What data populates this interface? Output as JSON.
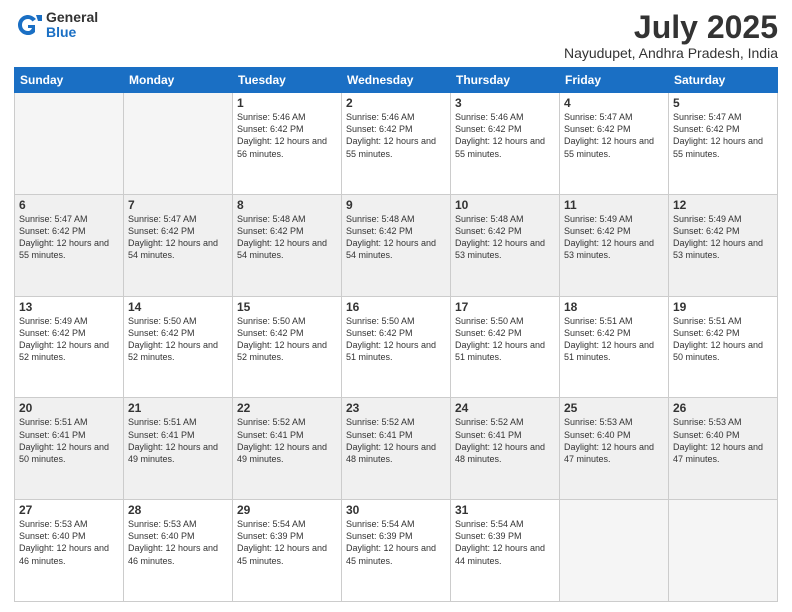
{
  "header": {
    "logo_general": "General",
    "logo_blue": "Blue",
    "title": "July 2025",
    "subtitle": "Nayudupet, Andhra Pradesh, India"
  },
  "weekdays": [
    "Sunday",
    "Monday",
    "Tuesday",
    "Wednesday",
    "Thursday",
    "Friday",
    "Saturday"
  ],
  "weeks": [
    [
      {
        "day": "",
        "info": ""
      },
      {
        "day": "",
        "info": ""
      },
      {
        "day": "1",
        "info": "Sunrise: 5:46 AM\nSunset: 6:42 PM\nDaylight: 12 hours and 56 minutes."
      },
      {
        "day": "2",
        "info": "Sunrise: 5:46 AM\nSunset: 6:42 PM\nDaylight: 12 hours and 55 minutes."
      },
      {
        "day": "3",
        "info": "Sunrise: 5:46 AM\nSunset: 6:42 PM\nDaylight: 12 hours and 55 minutes."
      },
      {
        "day": "4",
        "info": "Sunrise: 5:47 AM\nSunset: 6:42 PM\nDaylight: 12 hours and 55 minutes."
      },
      {
        "day": "5",
        "info": "Sunrise: 5:47 AM\nSunset: 6:42 PM\nDaylight: 12 hours and 55 minutes."
      }
    ],
    [
      {
        "day": "6",
        "info": "Sunrise: 5:47 AM\nSunset: 6:42 PM\nDaylight: 12 hours and 55 minutes."
      },
      {
        "day": "7",
        "info": "Sunrise: 5:47 AM\nSunset: 6:42 PM\nDaylight: 12 hours and 54 minutes."
      },
      {
        "day": "8",
        "info": "Sunrise: 5:48 AM\nSunset: 6:42 PM\nDaylight: 12 hours and 54 minutes."
      },
      {
        "day": "9",
        "info": "Sunrise: 5:48 AM\nSunset: 6:42 PM\nDaylight: 12 hours and 54 minutes."
      },
      {
        "day": "10",
        "info": "Sunrise: 5:48 AM\nSunset: 6:42 PM\nDaylight: 12 hours and 53 minutes."
      },
      {
        "day": "11",
        "info": "Sunrise: 5:49 AM\nSunset: 6:42 PM\nDaylight: 12 hours and 53 minutes."
      },
      {
        "day": "12",
        "info": "Sunrise: 5:49 AM\nSunset: 6:42 PM\nDaylight: 12 hours and 53 minutes."
      }
    ],
    [
      {
        "day": "13",
        "info": "Sunrise: 5:49 AM\nSunset: 6:42 PM\nDaylight: 12 hours and 52 minutes."
      },
      {
        "day": "14",
        "info": "Sunrise: 5:50 AM\nSunset: 6:42 PM\nDaylight: 12 hours and 52 minutes."
      },
      {
        "day": "15",
        "info": "Sunrise: 5:50 AM\nSunset: 6:42 PM\nDaylight: 12 hours and 52 minutes."
      },
      {
        "day": "16",
        "info": "Sunrise: 5:50 AM\nSunset: 6:42 PM\nDaylight: 12 hours and 51 minutes."
      },
      {
        "day": "17",
        "info": "Sunrise: 5:50 AM\nSunset: 6:42 PM\nDaylight: 12 hours and 51 minutes."
      },
      {
        "day": "18",
        "info": "Sunrise: 5:51 AM\nSunset: 6:42 PM\nDaylight: 12 hours and 51 minutes."
      },
      {
        "day": "19",
        "info": "Sunrise: 5:51 AM\nSunset: 6:42 PM\nDaylight: 12 hours and 50 minutes."
      }
    ],
    [
      {
        "day": "20",
        "info": "Sunrise: 5:51 AM\nSunset: 6:41 PM\nDaylight: 12 hours and 50 minutes."
      },
      {
        "day": "21",
        "info": "Sunrise: 5:51 AM\nSunset: 6:41 PM\nDaylight: 12 hours and 49 minutes."
      },
      {
        "day": "22",
        "info": "Sunrise: 5:52 AM\nSunset: 6:41 PM\nDaylight: 12 hours and 49 minutes."
      },
      {
        "day": "23",
        "info": "Sunrise: 5:52 AM\nSunset: 6:41 PM\nDaylight: 12 hours and 48 minutes."
      },
      {
        "day": "24",
        "info": "Sunrise: 5:52 AM\nSunset: 6:41 PM\nDaylight: 12 hours and 48 minutes."
      },
      {
        "day": "25",
        "info": "Sunrise: 5:53 AM\nSunset: 6:40 PM\nDaylight: 12 hours and 47 minutes."
      },
      {
        "day": "26",
        "info": "Sunrise: 5:53 AM\nSunset: 6:40 PM\nDaylight: 12 hours and 47 minutes."
      }
    ],
    [
      {
        "day": "27",
        "info": "Sunrise: 5:53 AM\nSunset: 6:40 PM\nDaylight: 12 hours and 46 minutes."
      },
      {
        "day": "28",
        "info": "Sunrise: 5:53 AM\nSunset: 6:40 PM\nDaylight: 12 hours and 46 minutes."
      },
      {
        "day": "29",
        "info": "Sunrise: 5:54 AM\nSunset: 6:39 PM\nDaylight: 12 hours and 45 minutes."
      },
      {
        "day": "30",
        "info": "Sunrise: 5:54 AM\nSunset: 6:39 PM\nDaylight: 12 hours and 45 minutes."
      },
      {
        "day": "31",
        "info": "Sunrise: 5:54 AM\nSunset: 6:39 PM\nDaylight: 12 hours and 44 minutes."
      },
      {
        "day": "",
        "info": ""
      },
      {
        "day": "",
        "info": ""
      }
    ]
  ]
}
